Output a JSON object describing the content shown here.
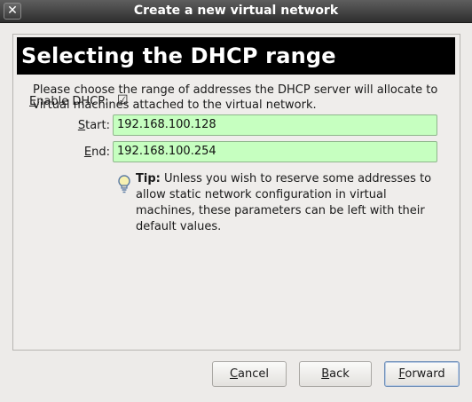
{
  "window": {
    "title": "Create a new virtual network",
    "close_glyph": "✕"
  },
  "page": {
    "heading": "Selecting the DHCP range",
    "intro": "Please choose the range of addresses the DHCP server will allocate to virtual machines attached to the virtual network."
  },
  "dhcp": {
    "enable_label_mnemonic": "E",
    "enable_label_rest": "nable DHCP:",
    "enabled": true,
    "checkmark": "☑",
    "start_label_mnemonic": "S",
    "start_label_rest": "tart:",
    "start_value": "192.168.100.128",
    "end_label_mnemonic": "E",
    "end_label_rest": "nd:",
    "end_value": "192.168.100.254"
  },
  "tip": {
    "icon": "lightbulb-icon",
    "label": "Tip:",
    "text": " Unless you wish to reserve some addresses to allow static network configuration in virtual machines, these parameters can be left with their default values."
  },
  "buttons": {
    "cancel_mnemonic": "C",
    "cancel_rest": "ancel",
    "back_mnemonic": "B",
    "back_rest": "ack",
    "forward_mnemonic": "F",
    "forward_rest": "orward"
  },
  "colors": {
    "field_background": "#c6ffc0",
    "banner": "#000000"
  }
}
